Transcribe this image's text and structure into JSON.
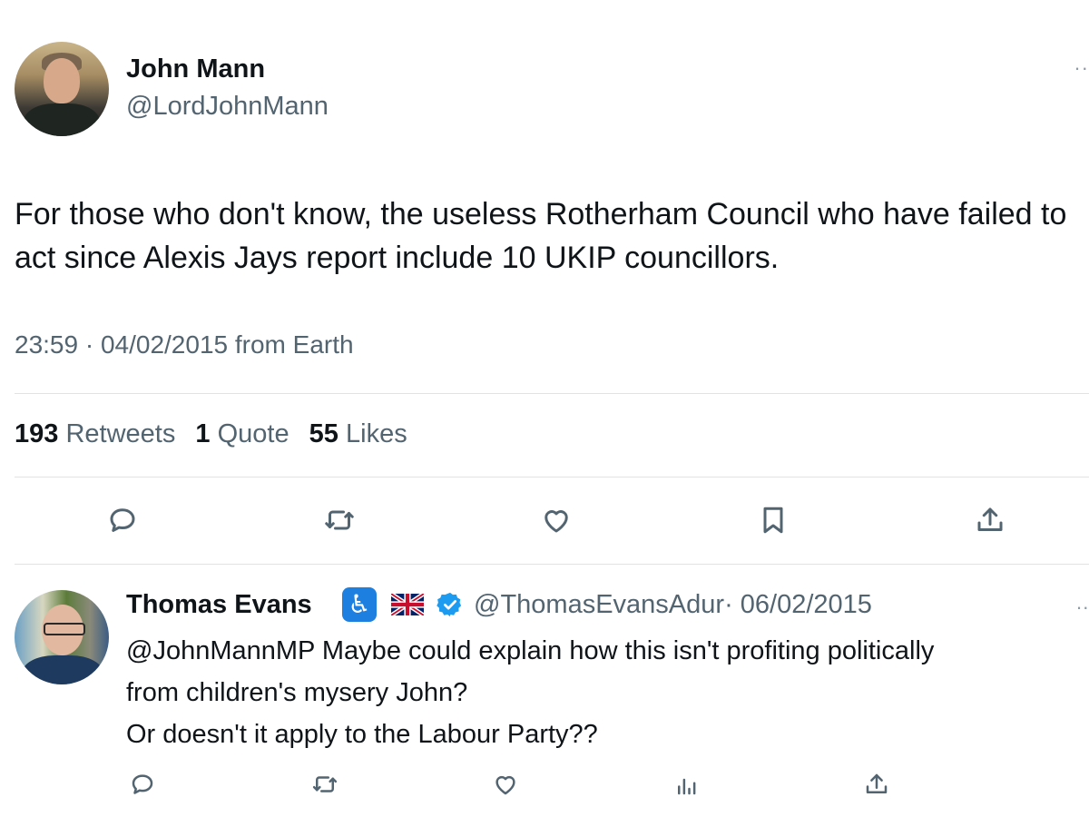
{
  "tweet": {
    "author_name": "John Mann",
    "author_handle": "@LordJohnMann",
    "more_label": "··",
    "text": "For those who don't know, the useless Rotherham Council who have failed to act since Alexis Jays report include 10 UKIP councillors.",
    "time": "23:59 · 04/02/2015 from Earth",
    "stats": {
      "retweets_count": "193",
      "retweets_label": "Retweets",
      "quotes_count": "1",
      "quotes_label": "Quote",
      "likes_count": "55",
      "likes_label": "Likes"
    },
    "actions": [
      "reply-icon",
      "retweet-icon",
      "like-icon",
      "bookmark-icon",
      "share-icon"
    ]
  },
  "reply": {
    "author_name": "Thomas Evans",
    "badge_icon": "wheelchair-icon",
    "flag_icon": "uk-flag-icon",
    "verified_icon": "verified-icon",
    "author_handle": "@ThomasEvansAdur",
    "date": "· 06/02/2015",
    "more_label": "··",
    "text_lines": [
      "@JohnMannMP Maybe could explain how this isn't profiting politically",
      "from children's mysery John?",
      "Or doesn't it apply to the Labour Party??"
    ],
    "actions": [
      "reply-icon",
      "retweet-icon",
      "like-icon",
      "views-icon",
      "share-icon"
    ]
  },
  "colors": {
    "text": "#0f1419",
    "muted": "#536471",
    "divider": "#dfe3e6",
    "verified": "#1d9bf0",
    "badge": "#1d7fe0"
  }
}
